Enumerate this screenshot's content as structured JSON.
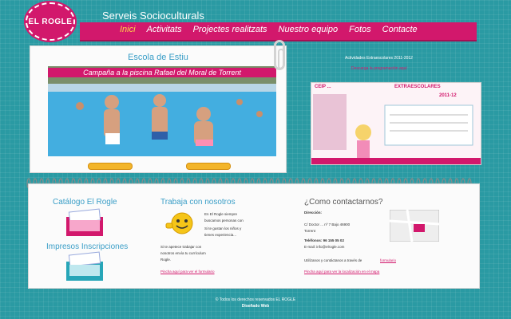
{
  "header": {
    "logo_text": "EL ROGLE",
    "tagline": "Serveis Socioculturals"
  },
  "nav": {
    "items": [
      "Inici",
      "Activitats",
      "Projectes realitzats",
      "Nuestro equipo",
      "Fotos",
      "Contacte"
    ],
    "active": "Inici"
  },
  "featured": {
    "title": "Escola de Estiu",
    "caption": "Campaña a la piscina Rafael del Moral de Torrent"
  },
  "sidebar": {
    "title": "Actividades Extraescolares 2011-2012",
    "link": "Descarga la programación aquí",
    "poster_title": "CEIP ...",
    "poster_subtitle": "EXTRAESCOLARES",
    "poster_year": "2011-12"
  },
  "notebook": {
    "catalog_title": "Catálogo El Rogle",
    "enroll_title": "Impresos Inscripciones",
    "work_title": "Trabaja con nosotros",
    "work_text": [
      "En El Rogle siempre",
      "buscamos personas con",
      "Si te gustan los niños y",
      "tienes experiencia...",
      "Si te apetece trabajar con",
      "nosotros envía tu currículum",
      "Rogle."
    ],
    "work_link": "Pincha aquí para ver el formulario",
    "contact_title": "¿Como contactarnos?",
    "contact_lines": [
      "Dirección:",
      "C/ Doctor ... nº 7 Bajo 46900",
      "Torrent",
      "Teléfonos: 96 155 05 02",
      "E-mail: info@elrogle.com"
    ],
    "contact_more": "Utilízanos y contáctanos a través de",
    "contact_more_link": "formulario",
    "contact_link2": "Pincha aquí para ver la localización en el mapa"
  },
  "footer": {
    "line1": "© Todos los derechos reservados EL ROGLE",
    "line2": "Diseñado Web"
  },
  "colors": {
    "background": "#2a9aa3",
    "accent": "#d2186c",
    "nav_active": "#ffd54a",
    "title_blue": "#3a9ec7"
  },
  "icons": [
    "catalog-icon",
    "enroll-forms-icon",
    "smiley-icon",
    "map-icon",
    "paperclip-icon"
  ]
}
